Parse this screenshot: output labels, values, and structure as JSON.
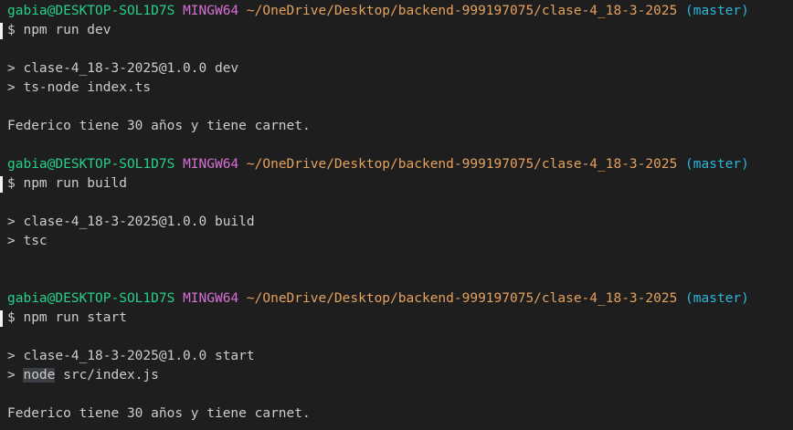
{
  "prompts": [
    {
      "user_host": "gabia@DESKTOP-SOL1D7S",
      "system": "MINGW64",
      "path": "~/OneDrive/Desktop/backend-999197075/clase-4_18-3-2025",
      "branch": "(master)",
      "command": "$ npm run dev"
    },
    {
      "user_host": "gabia@DESKTOP-SOL1D7S",
      "system": "MINGW64",
      "path": "~/OneDrive/Desktop/backend-999197075/clase-4_18-3-2025",
      "branch": "(master)",
      "command": "$ npm run build"
    },
    {
      "user_host": "gabia@DESKTOP-SOL1D7S",
      "system": "MINGW64",
      "path": "~/OneDrive/Desktop/backend-999197075/clase-4_18-3-2025",
      "branch": "(master)",
      "command": "$ npm run start"
    }
  ],
  "outputs": {
    "dev_script": "> clase-4_18-3-2025@1.0.0 dev",
    "dev_exec": "> ts-node index.ts",
    "dev_result": "Federico tiene 30 años y tiene carnet.",
    "build_script": "> clase-4_18-3-2025@1.0.0 build",
    "build_exec": "> tsc",
    "start_script": "> clase-4_18-3-2025@1.0.0 start",
    "start_exec_prefix": "> ",
    "start_exec_highlight": "node",
    "start_exec_rest": " src/index.js",
    "start_result": "Federico tiene 30 años y tiene carnet."
  }
}
